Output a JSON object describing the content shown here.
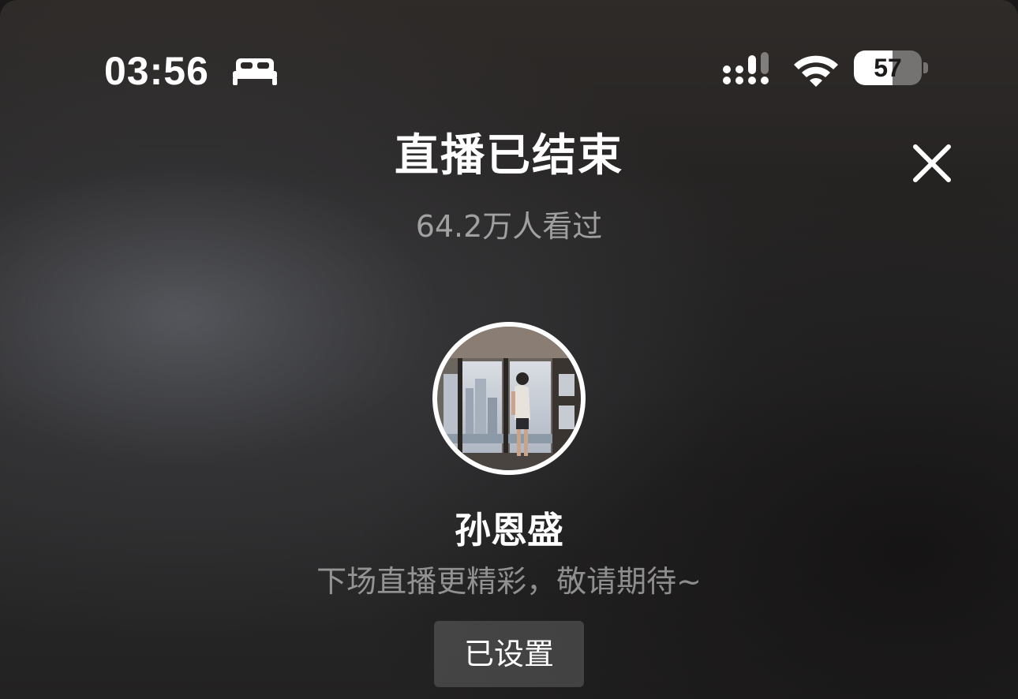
{
  "status_bar": {
    "time": "03:56",
    "sleep_icon": "bed-icon",
    "signal_icon": "cellular-signal-icon",
    "wifi_icon": "wifi-icon",
    "battery_level": "57",
    "battery_percent": 57
  },
  "header": {
    "title": "直播已结束",
    "close_icon": "close-icon"
  },
  "stats": {
    "viewers": "64.2万人看过"
  },
  "streamer": {
    "name": "孙恩盛",
    "message": "下场直播更精彩，敬请期待~"
  },
  "reminder": {
    "label": "已设置"
  },
  "colors": {
    "text_primary": "#ffffff",
    "text_secondary": "#8c8c8c",
    "button_bg": "#3f3e3e"
  }
}
